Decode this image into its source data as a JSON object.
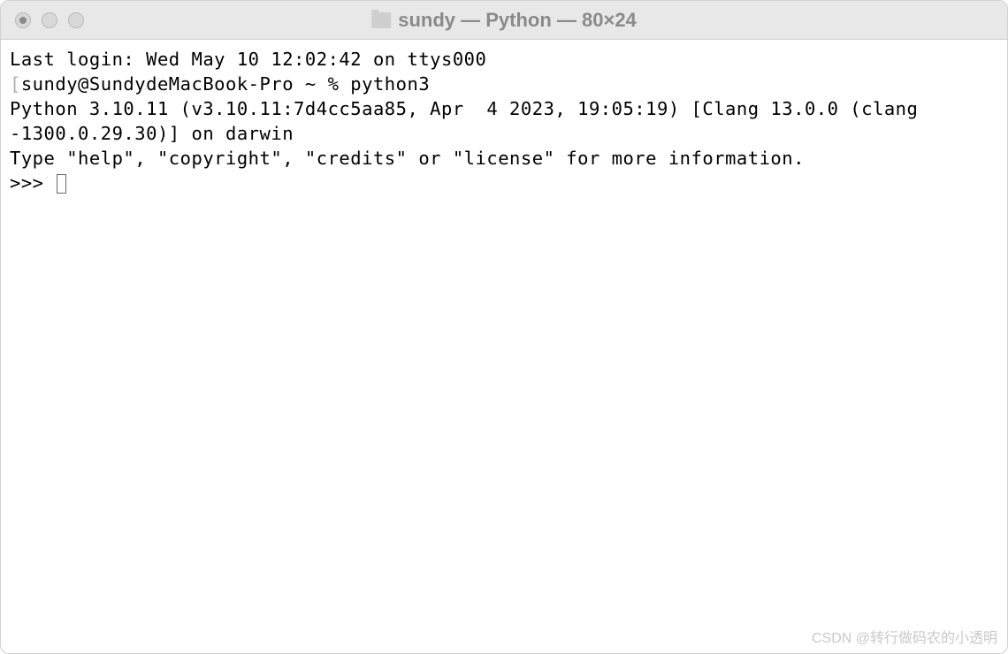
{
  "titlebar": {
    "title": "sundy — Python — 80×24"
  },
  "terminal": {
    "last_login": "Last login: Wed May 10 12:02:42 on ttys000",
    "shell_prompt": "sundy@SundydeMacBook-Pro ~ % ",
    "command": "python3",
    "python_version_line1": "Python 3.10.11 (v3.10.11:7d4cc5aa85, Apr  4 2023, 19:05:19) [Clang 13.0.0 (clang",
    "python_version_line2": "-1300.0.29.30)] on darwin",
    "help_line": "Type \"help\", \"copyright\", \"credits\" or \"license\" for more information.",
    "python_prompt": ">>> "
  },
  "watermark": "CSDN @转行做码农的小透明"
}
